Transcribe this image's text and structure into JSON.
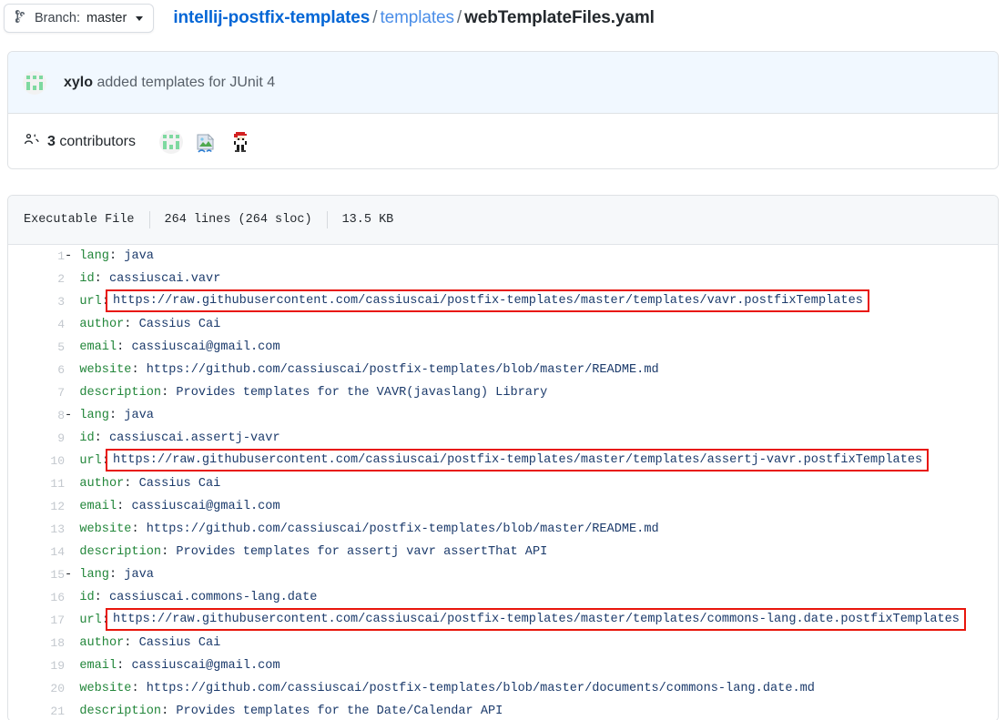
{
  "topbar": {
    "branch_icon": "git-branch-icon",
    "branch_label": "Branch:",
    "branch_name": "master",
    "caret_icon": "chevron-down-icon",
    "breadcrumb": {
      "repo": "intellij-postfix-templates",
      "sep1": "/",
      "dir": "templates",
      "sep2": "/",
      "file": "webTemplateFiles.yaml"
    }
  },
  "commit": {
    "avatar_icon": "identicon-avatar",
    "author": "xylo",
    "message": "added templates for JUnit 4"
  },
  "contributors": {
    "people_icon": "people-icon",
    "count_label": "3",
    "label": "contributors",
    "avatars": [
      {
        "name": "contributor-avatar-identicon"
      },
      {
        "name": "contributor-avatar-broken-image"
      },
      {
        "name": "contributor-avatar-pixel-character"
      }
    ]
  },
  "file_header": {
    "mode": "Executable File",
    "lines": "264 lines (264 sloc)",
    "size": "13.5 KB"
  },
  "colors": {
    "link": "#0366d6",
    "yaml_key": "#22863a",
    "yaml_value": "#1b3a6b",
    "highlight_box": "#e8160c",
    "commit_bg": "#f1f8ff",
    "header_bg": "#f6f8fa"
  },
  "code": {
    "language": "yaml",
    "lines": [
      {
        "n": "1",
        "tokens": [
          {
            "t": "d",
            "s": "- "
          },
          {
            "t": "k",
            "s": "lang"
          },
          {
            "t": "p",
            "s": ": "
          },
          {
            "t": "v",
            "s": "java"
          }
        ]
      },
      {
        "n": "2",
        "tokens": [
          {
            "t": "d",
            "s": "  "
          },
          {
            "t": "k",
            "s": "id"
          },
          {
            "t": "p",
            "s": ": "
          },
          {
            "t": "v",
            "s": "cassiuscai.vavr"
          }
        ]
      },
      {
        "n": "3",
        "tokens": [
          {
            "t": "d",
            "s": "  "
          },
          {
            "t": "k",
            "s": "url"
          },
          {
            "t": "p",
            "s": ":"
          },
          {
            "t": "box",
            "s": "https://raw.githubusercontent.com/cassiuscai/postfix-templates/master/templates/vavr.postfixTemplates"
          }
        ]
      },
      {
        "n": "4",
        "tokens": [
          {
            "t": "d",
            "s": "  "
          },
          {
            "t": "k",
            "s": "author"
          },
          {
            "t": "p",
            "s": ": "
          },
          {
            "t": "v",
            "s": "Cassius Cai"
          }
        ]
      },
      {
        "n": "5",
        "tokens": [
          {
            "t": "d",
            "s": "  "
          },
          {
            "t": "k",
            "s": "email"
          },
          {
            "t": "p",
            "s": ": "
          },
          {
            "t": "v",
            "s": "cassiuscai@gmail.com"
          }
        ]
      },
      {
        "n": "6",
        "tokens": [
          {
            "t": "d",
            "s": "  "
          },
          {
            "t": "k",
            "s": "website"
          },
          {
            "t": "p",
            "s": ": "
          },
          {
            "t": "v",
            "s": "https://github.com/cassiuscai/postfix-templates/blob/master/README.md"
          }
        ]
      },
      {
        "n": "7",
        "tokens": [
          {
            "t": "d",
            "s": "  "
          },
          {
            "t": "k",
            "s": "description"
          },
          {
            "t": "p",
            "s": ": "
          },
          {
            "t": "v",
            "s": "Provides templates for the VAVR(javaslang) Library"
          }
        ]
      },
      {
        "n": "8",
        "tokens": [
          {
            "t": "d",
            "s": "- "
          },
          {
            "t": "k",
            "s": "lang"
          },
          {
            "t": "p",
            "s": ": "
          },
          {
            "t": "v",
            "s": "java"
          }
        ]
      },
      {
        "n": "9",
        "tokens": [
          {
            "t": "d",
            "s": "  "
          },
          {
            "t": "k",
            "s": "id"
          },
          {
            "t": "p",
            "s": ": "
          },
          {
            "t": "v",
            "s": "cassiuscai.assertj-vavr"
          }
        ]
      },
      {
        "n": "10",
        "tokens": [
          {
            "t": "d",
            "s": "  "
          },
          {
            "t": "k",
            "s": "url"
          },
          {
            "t": "p",
            "s": ":"
          },
          {
            "t": "box",
            "s": "https://raw.githubusercontent.com/cassiuscai/postfix-templates/master/templates/assertj-vavr.postfixTemplates"
          }
        ]
      },
      {
        "n": "11",
        "tokens": [
          {
            "t": "d",
            "s": "  "
          },
          {
            "t": "k",
            "s": "author"
          },
          {
            "t": "p",
            "s": ": "
          },
          {
            "t": "v",
            "s": "Cassius Cai"
          }
        ]
      },
      {
        "n": "12",
        "tokens": [
          {
            "t": "d",
            "s": "  "
          },
          {
            "t": "k",
            "s": "email"
          },
          {
            "t": "p",
            "s": ": "
          },
          {
            "t": "v",
            "s": "cassiuscai@gmail.com"
          }
        ]
      },
      {
        "n": "13",
        "tokens": [
          {
            "t": "d",
            "s": "  "
          },
          {
            "t": "k",
            "s": "website"
          },
          {
            "t": "p",
            "s": ": "
          },
          {
            "t": "v",
            "s": "https://github.com/cassiuscai/postfix-templates/blob/master/README.md"
          }
        ]
      },
      {
        "n": "14",
        "tokens": [
          {
            "t": "d",
            "s": "  "
          },
          {
            "t": "k",
            "s": "description"
          },
          {
            "t": "p",
            "s": ": "
          },
          {
            "t": "v",
            "s": "Provides templates for assertj vavr assertThat API"
          }
        ]
      },
      {
        "n": "15",
        "tokens": [
          {
            "t": "d",
            "s": "- "
          },
          {
            "t": "k",
            "s": "lang"
          },
          {
            "t": "p",
            "s": ": "
          },
          {
            "t": "v",
            "s": "java"
          }
        ]
      },
      {
        "n": "16",
        "tokens": [
          {
            "t": "d",
            "s": "  "
          },
          {
            "t": "k",
            "s": "id"
          },
          {
            "t": "p",
            "s": ": "
          },
          {
            "t": "v",
            "s": "cassiuscai.commons-lang.date"
          }
        ]
      },
      {
        "n": "17",
        "tokens": [
          {
            "t": "d",
            "s": "  "
          },
          {
            "t": "k",
            "s": "url"
          },
          {
            "t": "p",
            "s": ":"
          },
          {
            "t": "box",
            "s": "https://raw.githubusercontent.com/cassiuscai/postfix-templates/master/templates/commons-lang.date.postfixTemplates"
          }
        ]
      },
      {
        "n": "18",
        "tokens": [
          {
            "t": "d",
            "s": "  "
          },
          {
            "t": "k",
            "s": "author"
          },
          {
            "t": "p",
            "s": ": "
          },
          {
            "t": "v",
            "s": "Cassius Cai"
          }
        ]
      },
      {
        "n": "19",
        "tokens": [
          {
            "t": "d",
            "s": "  "
          },
          {
            "t": "k",
            "s": "email"
          },
          {
            "t": "p",
            "s": ": "
          },
          {
            "t": "v",
            "s": "cassiuscai@gmail.com"
          }
        ]
      },
      {
        "n": "20",
        "tokens": [
          {
            "t": "d",
            "s": "  "
          },
          {
            "t": "k",
            "s": "website"
          },
          {
            "t": "p",
            "s": ": "
          },
          {
            "t": "v",
            "s": "https://github.com/cassiuscai/postfix-templates/blob/master/documents/commons-lang.date.md"
          }
        ]
      },
      {
        "n": "21",
        "tokens": [
          {
            "t": "d",
            "s": "  "
          },
          {
            "t": "k",
            "s": "description"
          },
          {
            "t": "p",
            "s": ": "
          },
          {
            "t": "v",
            "s": "Provides templates for the Date/Calendar API"
          }
        ]
      }
    ]
  }
}
